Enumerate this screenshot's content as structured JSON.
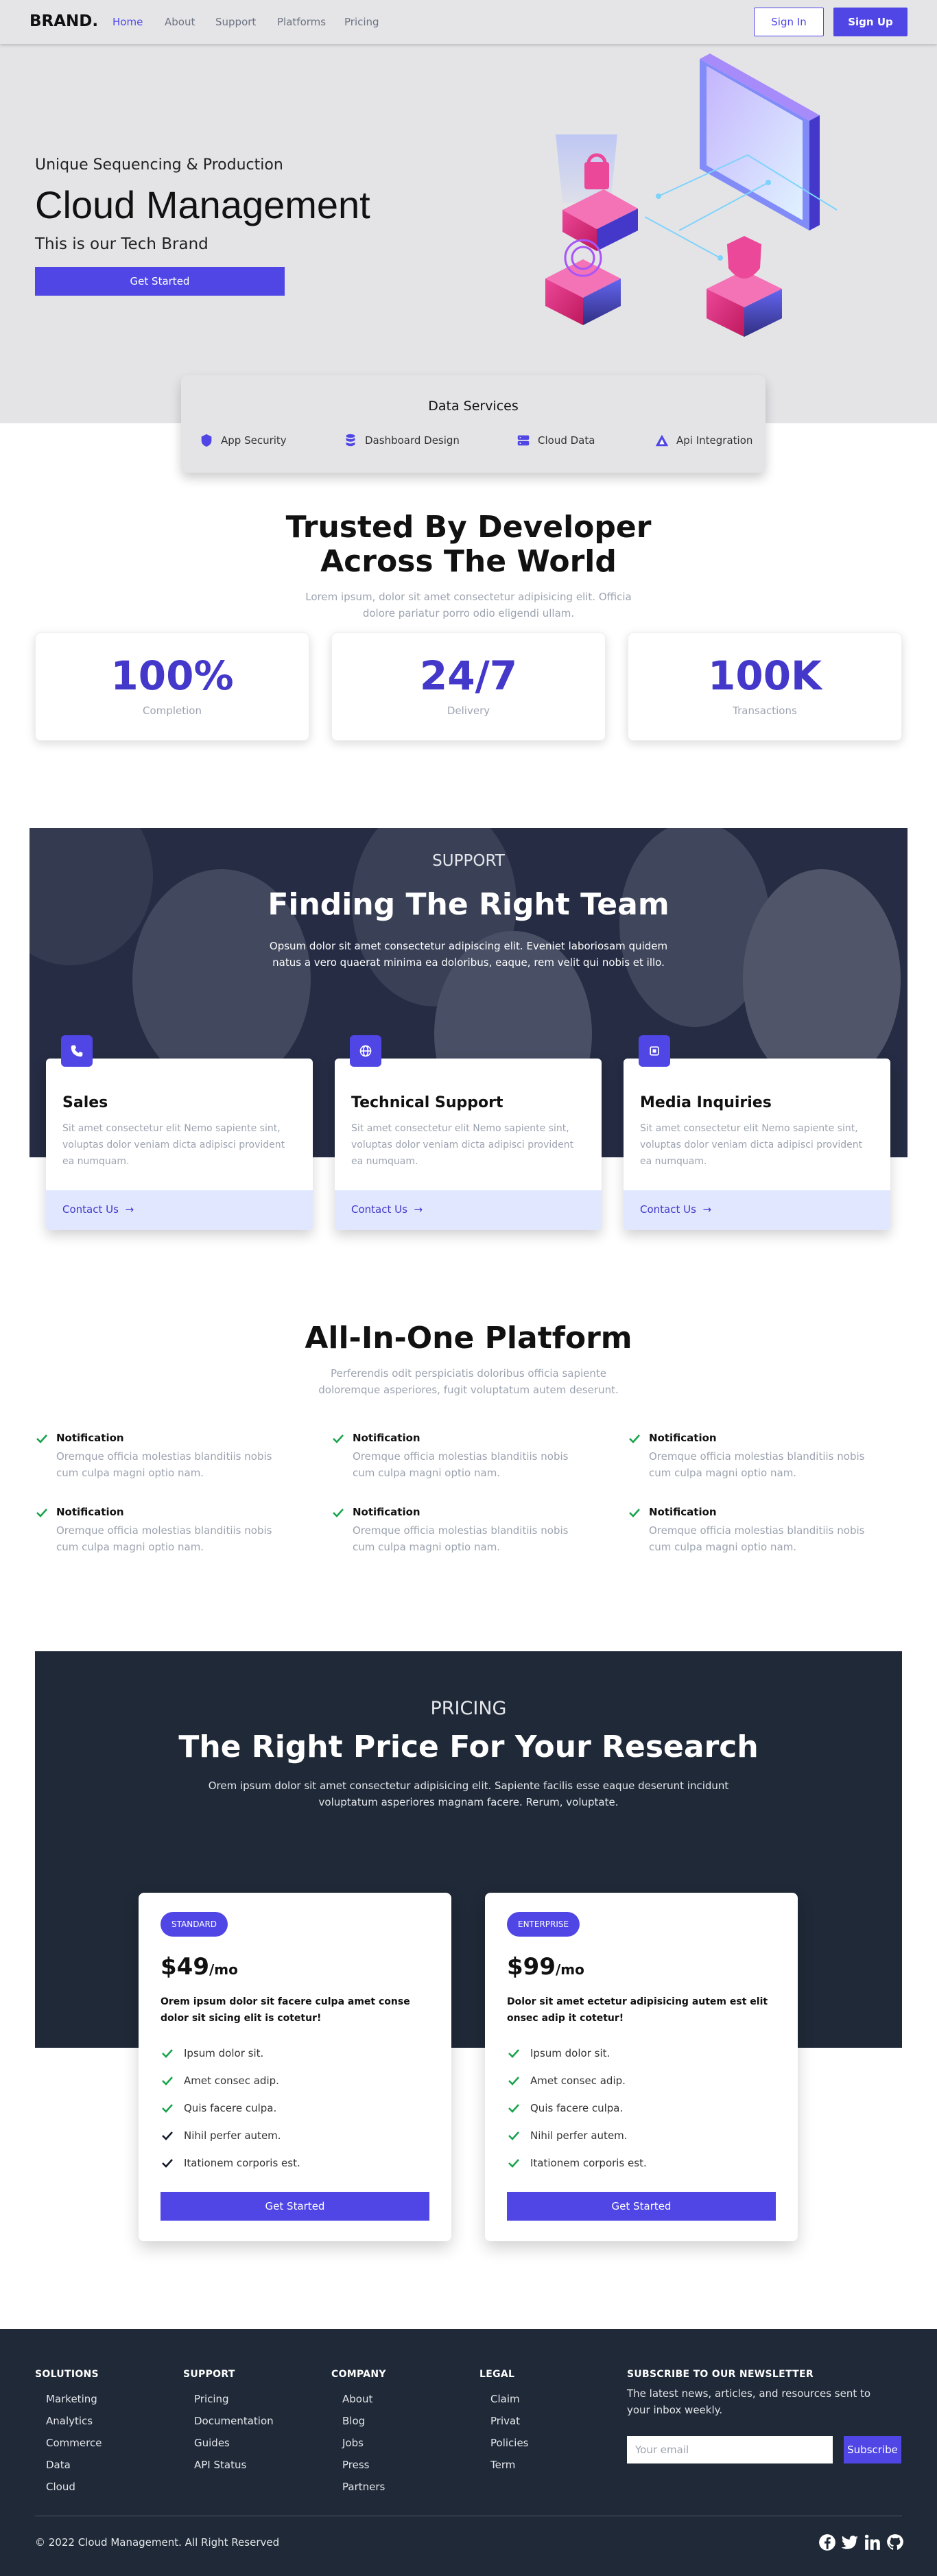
{
  "nav": {
    "brand": "BRAND.",
    "links": [
      "Home",
      "About",
      "Support",
      "Platforms",
      "Pricing"
    ],
    "sign_in": "Sign In",
    "sign_up": "Sign Up"
  },
  "hero": {
    "subtitle": "Unique Sequencing & Production",
    "title": "Cloud Management",
    "tagline": "This is our Tech Brand",
    "cta": "Get Started"
  },
  "services": {
    "title": "Data Services",
    "items": [
      {
        "label": "App Security",
        "icon": "shield-icon"
      },
      {
        "label": "Dashboard Design",
        "icon": "database-icon"
      },
      {
        "label": "Cloud Data",
        "icon": "server-icon"
      },
      {
        "label": "Api Integration",
        "icon": "triangle-icon"
      }
    ]
  },
  "trusted": {
    "title_line1": "Trusted By Developer",
    "title_line2": "Across The World",
    "text_line1": "Lorem ipsum, dolor sit amet consectetur adipisicing elit. Officia",
    "text_line2": "dolore pariatur porro odio eligendi ullam.",
    "stats": [
      {
        "value": "100%",
        "label": "Completion"
      },
      {
        "value": "24/7",
        "label": "Delivery"
      },
      {
        "value": "100K",
        "label": "Transactions"
      }
    ]
  },
  "support": {
    "eyebrow": "SUPPORT",
    "title": "Finding The Right Team",
    "text_line1": "Opsum dolor sit amet consectetur adipiscing elit. Eveniet laboriosam quidem",
    "text_line2": "natus a vero quaerat minima ea doloribus, eaque, rem velit qui nobis et illo.",
    "cards": [
      {
        "title": "Sales",
        "text": "Sit amet consectetur elit Nemo sapiente sint, voluptas dolor veniam dicta adipisci provident ea numquam.",
        "link": "Contact Us",
        "icon": "phone-icon"
      },
      {
        "title": "Technical Support",
        "text": "Sit amet consectetur elit Nemo sapiente sint, voluptas dolor veniam dicta adipisci provident ea numquam.",
        "link": "Contact Us",
        "icon": "globe-icon"
      },
      {
        "title": "Media Inquiries",
        "text": "Sit amet consectetur elit Nemo sapiente sint, voluptas dolor veniam dicta adipisci provident ea numquam.",
        "link": "Contact Us",
        "icon": "chip-icon"
      }
    ]
  },
  "platform": {
    "title": "All-In-One Platform",
    "text_line1": "Perferendis odit perspiciatis doloribus officia sapiente",
    "text_line2": "doloremque asperiores, fugit voluptatum autem deserunt.",
    "features": [
      {
        "title": "Notification",
        "text": "Oremque officia molestias blanditiis nobis cum culpa magni optio nam."
      },
      {
        "title": "Notification",
        "text": "Oremque officia molestias blanditiis nobis cum culpa magni optio nam."
      },
      {
        "title": "Notification",
        "text": "Oremque officia molestias blanditiis nobis cum culpa magni optio nam."
      },
      {
        "title": "Notification",
        "text": "Oremque officia molestias blanditiis nobis cum culpa magni optio nam."
      },
      {
        "title": "Notification",
        "text": "Oremque officia molestias blanditiis nobis cum culpa magni optio nam."
      },
      {
        "title": "Notification",
        "text": "Oremque officia molestias blanditiis nobis cum culpa magni optio nam."
      }
    ]
  },
  "pricing": {
    "eyebrow": "PRICING",
    "title": "The Right Price For Your Research",
    "text_line1": "Orem ipsum dolor sit amet consectetur adipisicing elit. Sapiente facilis esse eaque deserunt incidunt",
    "text_line2": "voluptatum asperiores magnam facere. Rerum, voluptate.",
    "plans": [
      {
        "badge": "STANDARD",
        "amount": "$49",
        "period": "/mo",
        "desc": "Orem ipsum dolor sit facere culpa amet conse dolor sit sicing elit is cotetur!",
        "features": [
          "Ipsum dolor sit.",
          "Amet consec adip.",
          "Quis facere culpa.",
          "Nihil perfer autem.",
          "Itationem corporis est."
        ],
        "cta": "Get Started"
      },
      {
        "badge": "ENTERPRISE",
        "amount": "$99",
        "period": "/mo",
        "desc": "Dolor sit amet ectetur adipisicing autem est elit onsec adip it cotetur!",
        "features": [
          "Ipsum dolor sit.",
          "Amet consec adip.",
          "Quis facere culpa.",
          "Nihil perfer autem.",
          "Itationem corporis est."
        ],
        "cta": "Get Started"
      }
    ]
  },
  "footer": {
    "columns": [
      {
        "title": "SOLUTIONS",
        "links": [
          "Marketing",
          "Analytics",
          "Commerce",
          "Data",
          "Cloud"
        ]
      },
      {
        "title": "SUPPORT",
        "links": [
          "Pricing",
          "Documentation",
          "Guides",
          "API Status"
        ]
      },
      {
        "title": "COMPANY",
        "links": [
          "About",
          "Blog",
          "Jobs",
          "Press",
          "Partners"
        ]
      },
      {
        "title": "LEGAL",
        "links": [
          "Claim",
          "Privat",
          "Policies",
          "Term"
        ]
      }
    ],
    "newsletter_title": "SUBSCRIBE TO OUR NEWSLETTER",
    "newsletter_text": "The latest news, articles, and resources sent to your inbox weekly.",
    "email_placeholder": "Your email",
    "subscribe": "Subscribe",
    "copyright": "© 2022 Cloud Management. All Right Reserved",
    "social_icons": [
      "facebook-icon",
      "twitter-icon",
      "linkedin-icon",
      "github-icon"
    ]
  },
  "colors": {
    "accent": "#4f46e5",
    "dark": "#1f2937",
    "light": "#e4e4e7",
    "check_green": "#16a34a"
  }
}
